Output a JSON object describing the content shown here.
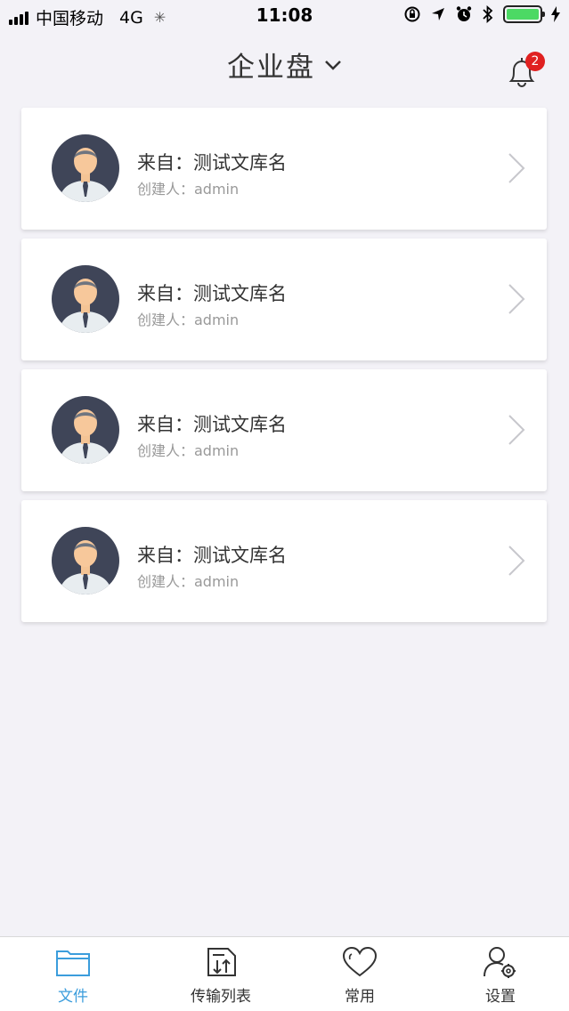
{
  "status_bar": {
    "carrier": "中国移动",
    "network": "4G",
    "time": "11:08",
    "battery_level": 1.0,
    "battery_color": "#4cd964"
  },
  "header": {
    "title": "企业盘",
    "dropdown_icon": "chevron-down-icon",
    "bell_icon": "bell-icon",
    "notification_count": "2"
  },
  "libraries": [
    {
      "title": "来自：测试文库名",
      "creator": "创建人：admin"
    },
    {
      "title": "来自：测试文库名",
      "creator": "创建人：admin"
    },
    {
      "title": "来自：测试文库名",
      "creator": "创建人：admin"
    },
    {
      "title": "来自：测试文库名",
      "creator": "创建人：admin"
    }
  ],
  "tabbar": {
    "active_color": "#3b9ddc",
    "tabs": [
      {
        "label": "文件",
        "icon": "folder-icon",
        "active": true
      },
      {
        "label": "传输列表",
        "icon": "transfer-icon",
        "active": false
      },
      {
        "label": "常用",
        "icon": "heart-icon",
        "active": false
      },
      {
        "label": "设置",
        "icon": "user-settings-icon",
        "active": false
      }
    ]
  }
}
